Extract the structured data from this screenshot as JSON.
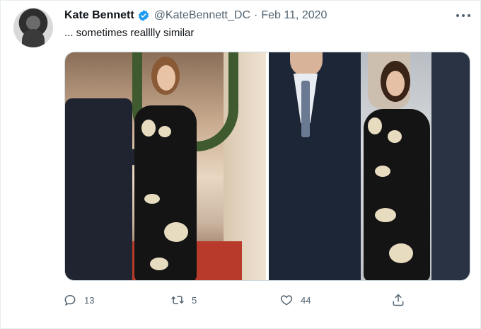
{
  "tweet": {
    "author": {
      "name": "Kate Bennett",
      "handle": "@KateBennett_DC",
      "verified": true
    },
    "separator": "·",
    "date": "Feb 11, 2020",
    "text": "... sometimes realllly similar",
    "more_icon": "ellipsis-icon"
  },
  "actions": {
    "replies": "13",
    "retweets": "5",
    "likes": "44",
    "icons": [
      "reply-icon",
      "retweet-icon",
      "like-icon",
      "share-icon"
    ]
  },
  "colors": {
    "verified": "#1d9bf0",
    "secondary_text": "#536471",
    "primary_text": "#0f1419"
  }
}
